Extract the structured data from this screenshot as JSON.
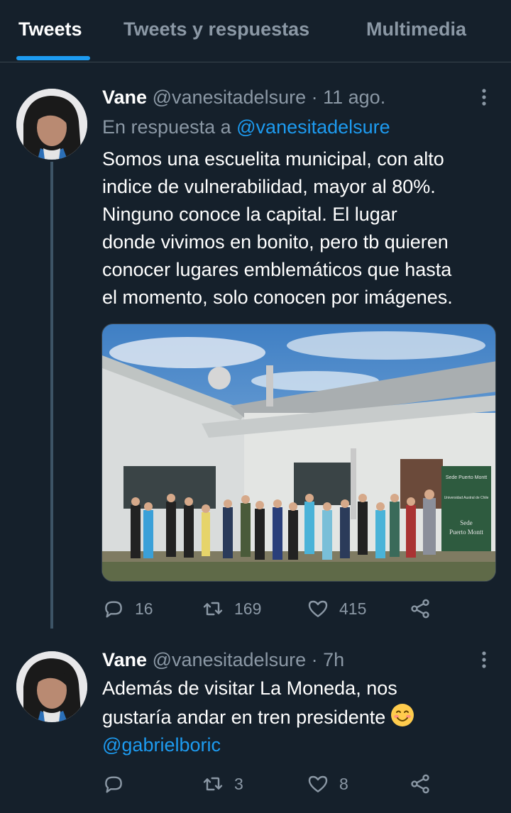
{
  "tabs": [
    {
      "label": "Tweets",
      "active": true
    },
    {
      "label": "Tweets y respuestas",
      "active": false
    },
    {
      "label": "Multimedia",
      "active": false
    }
  ],
  "tweets": [
    {
      "name": "Vane",
      "handle": "@vanesitadelsure",
      "separator": "·",
      "time": "11 ago.",
      "reply_prefix": "En respuesta a",
      "reply_handle": "@vanesitadelsure",
      "text_lines": [
        "Somos una escuelita municipal, con alto",
        "indice de vulnerabilidad, mayor al 80%.",
        "Ninguno conoce la capital. El lugar",
        "donde vivimos en bonito, pero tb quieren",
        "conocer lugares emblemáticos que hasta",
        "el momento, solo conocen por imágenes."
      ],
      "photo_sign": {
        "top": "Sede Puerto Montt",
        "org": "Universidad Austral de Chile",
        "main_1": "Sede",
        "main_2": "Puerto Montt"
      },
      "replies": "16",
      "retweets": "169",
      "likes": "415"
    },
    {
      "name": "Vane",
      "handle": "@vanesitadelsure",
      "separator": "·",
      "time": "7h",
      "text_lines": [
        "Además de visitar La Moneda, nos",
        "gustaría andar en tren presidente"
      ],
      "mention": "@gabrielboric",
      "replies": "",
      "retweets": "3",
      "likes": "8"
    }
  ],
  "icons": {
    "reply": "reply-icon",
    "retweet": "retweet-icon",
    "like": "heart-icon",
    "share": "share-icon",
    "more": "more-vertical-icon"
  },
  "colors": {
    "background": "#15202b",
    "accent": "#1d9bf0",
    "secondary_text": "#8b98a5"
  }
}
